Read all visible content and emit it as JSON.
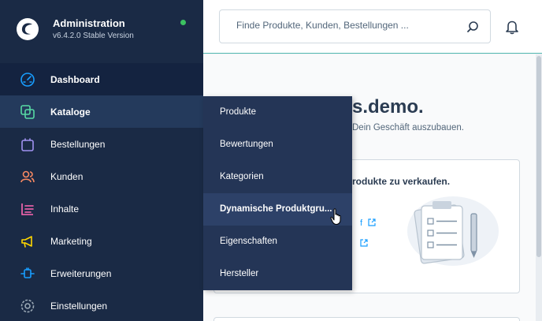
{
  "brand": {
    "title": "Administration",
    "version": "v6.4.2.0 Stable Version",
    "status_color": "#3cc261"
  },
  "sidebar": {
    "items": [
      {
        "label": "Dashboard",
        "icon": "dashboard-icon",
        "color": "#189eff"
      },
      {
        "label": "Kataloge",
        "icon": "catalog-icon",
        "color": "#57d9a3"
      },
      {
        "label": "Bestellungen",
        "icon": "orders-icon",
        "color": "#a092f0"
      },
      {
        "label": "Kunden",
        "icon": "customers-icon",
        "color": "#f88962"
      },
      {
        "label": "Inhalte",
        "icon": "content-icon",
        "color": "#ff68b4"
      },
      {
        "label": "Marketing",
        "icon": "marketing-icon",
        "color": "#ffd700"
      },
      {
        "label": "Erweiterungen",
        "icon": "extensions-icon",
        "color": "#189eff"
      },
      {
        "label": "Einstellungen",
        "icon": "settings-icon",
        "color": "#9aa8b5"
      }
    ]
  },
  "flyout": {
    "items": [
      {
        "label": "Produkte"
      },
      {
        "label": "Bewertungen"
      },
      {
        "label": "Kategorien"
      },
      {
        "label": "Dynamische Produktgru..."
      },
      {
        "label": "Eigenschaften"
      },
      {
        "label": "Hersteller"
      }
    ]
  },
  "search": {
    "placeholder": "Finde Produkte, Kunden, Bestellungen ..."
  },
  "main": {
    "welcome_title": "s.demo.",
    "welcome_subtitle": "Dein Geschäft auszubauen.",
    "card_title": "rodukte zu verkaufen.",
    "card_link1": "f",
    "card_link2": ""
  }
}
